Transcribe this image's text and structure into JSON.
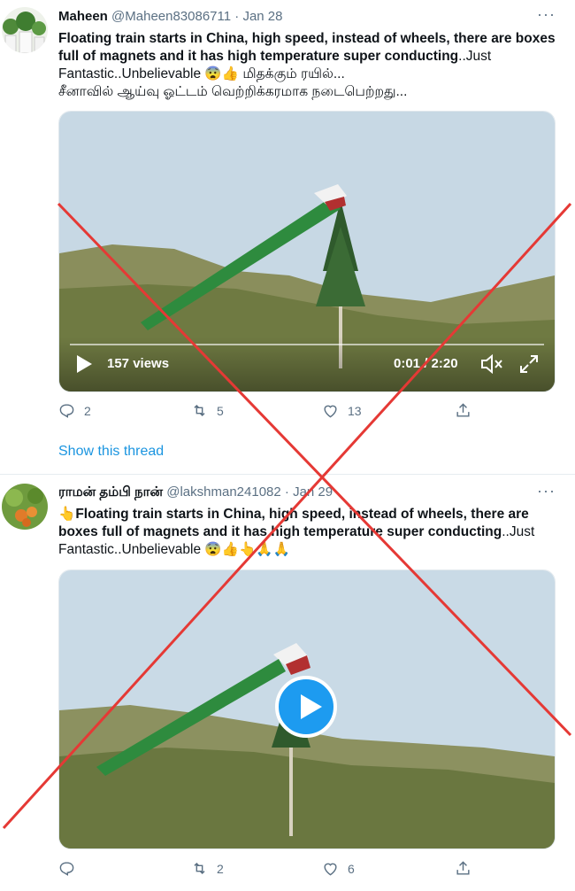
{
  "tweets": [
    {
      "name": "Maheen",
      "handle": "@Maheen83086711",
      "sep": "·",
      "date": "Jan 28",
      "more": "···",
      "text_bold_1": "Floating train starts in China, high speed, instead of wheels, there are boxes full of magnets and it has high temperature super conducting",
      "text_rest_1": "..Just Fantastic..Unbelievable 😨👍 மிதக்கும் ரயில்...",
      "text_line_3": "சீனாவில் ஆய்வு ஓட்டம் வெற்றிக்கரமாக நடைபெற்றது...",
      "video": {
        "views": "157 views",
        "time": "0:01 / 2:20"
      },
      "replies": "2",
      "retweets": "5",
      "likes": "13"
    },
    {
      "name": "ராமன் தம்பி நான்",
      "handle": "@lakshman241082",
      "sep": "·",
      "date": "Jan 29",
      "more": "···",
      "text_prefix": "👆",
      "text_bold_1": "Floating train starts in China, high speed, instead of wheels, there are boxes full of magnets and it has high temperature super conducting",
      "text_rest_1": "..Just Fantastic..Unbelievable 😨👍👆🙏🙏",
      "replies": "",
      "retweets": "2",
      "likes": "6"
    }
  ],
  "show_thread": "Show this thread",
  "colors": {
    "accent": "#1b95e0",
    "cross": "#e53935",
    "train": "#2e8b3e"
  },
  "icons": [
    "reply-icon",
    "retweet-icon",
    "like-icon",
    "share-icon",
    "play-icon",
    "mute-icon",
    "fullscreen-icon"
  ]
}
